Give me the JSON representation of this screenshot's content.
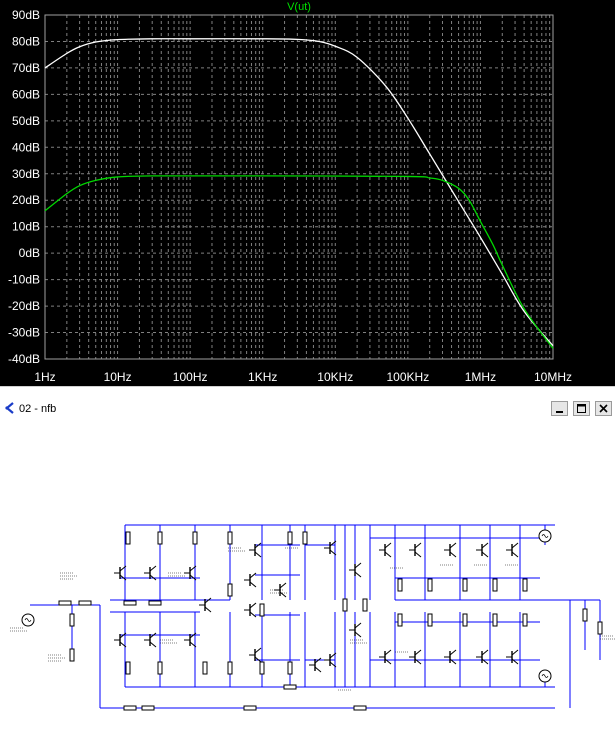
{
  "plot": {
    "background": "#000000",
    "grid_color": "#808080",
    "axis_label_color": "#ffffff"
  },
  "chart_data": {
    "type": "line",
    "title": "V(ut)",
    "title_color": "#00e000",
    "xscale": "log",
    "xlim": [
      1,
      10000000
    ],
    "ylim": [
      -40,
      90
    ],
    "ylabel_unit": "dB",
    "grid": true,
    "x_ticks": [
      {
        "value": 1,
        "label": "1Hz"
      },
      {
        "value": 10,
        "label": "10Hz"
      },
      {
        "value": 100,
        "label": "100Hz"
      },
      {
        "value": 1000,
        "label": "1KHz"
      },
      {
        "value": 10000,
        "label": "10KHz"
      },
      {
        "value": 100000,
        "label": "100KHz"
      },
      {
        "value": 1000000,
        "label": "1MHz"
      },
      {
        "value": 10000000,
        "label": "10MHz"
      }
    ],
    "y_ticks": [
      {
        "value": 90,
        "label": "90dB"
      },
      {
        "value": 80,
        "label": "80dB"
      },
      {
        "value": 70,
        "label": "70dB"
      },
      {
        "value": 60,
        "label": "60dB"
      },
      {
        "value": 50,
        "label": "50dB"
      },
      {
        "value": 40,
        "label": "40dB"
      },
      {
        "value": 30,
        "label": "30dB"
      },
      {
        "value": 20,
        "label": "20dB"
      },
      {
        "value": 10,
        "label": "10dB"
      },
      {
        "value": 0,
        "label": "0dB"
      },
      {
        "value": -10,
        "label": "-10dB"
      },
      {
        "value": -20,
        "label": "-20dB"
      },
      {
        "value": -30,
        "label": "-30dB"
      },
      {
        "value": -40,
        "label": "-40dB"
      }
    ],
    "series": [
      {
        "color": "#ffffff",
        "points": [
          [
            1,
            70
          ],
          [
            2,
            75.5
          ],
          [
            3,
            78
          ],
          [
            5,
            79.8
          ],
          [
            10,
            80.7
          ],
          [
            30,
            81
          ],
          [
            100,
            81
          ],
          [
            1000,
            81
          ],
          [
            3000,
            80.8
          ],
          [
            6000,
            80
          ],
          [
            10000,
            78.2
          ],
          [
            20000,
            74
          ],
          [
            50000,
            63
          ],
          [
            100000,
            51
          ],
          [
            200000,
            37.5
          ],
          [
            500000,
            19.5
          ],
          [
            1000000,
            6
          ],
          [
            2000000,
            -8
          ],
          [
            4000000,
            -22
          ],
          [
            10000000,
            -35
          ]
        ]
      },
      {
        "color": "#00d800",
        "points": [
          [
            1,
            16
          ],
          [
            2,
            22.5
          ],
          [
            3,
            25.5
          ],
          [
            5,
            27.5
          ],
          [
            10,
            28.8
          ],
          [
            30,
            29.2
          ],
          [
            1000,
            29.2
          ],
          [
            100000,
            29
          ],
          [
            200000,
            28.4
          ],
          [
            300000,
            27.5
          ],
          [
            500000,
            24.5
          ],
          [
            700000,
            20
          ],
          [
            1000000,
            12
          ],
          [
            1500000,
            3
          ],
          [
            2000000,
            -4.5
          ],
          [
            4000000,
            -21
          ],
          [
            10000000,
            -36
          ]
        ]
      }
    ]
  },
  "window": {
    "title": "02 - nfb",
    "icon": "ltspice-schematic-icon",
    "controls": [
      "minimize",
      "maximize",
      "close"
    ]
  },
  "schematic": {
    "wire_color": "#0000ff",
    "component_color": "#000000",
    "label_color": "#000000"
  }
}
